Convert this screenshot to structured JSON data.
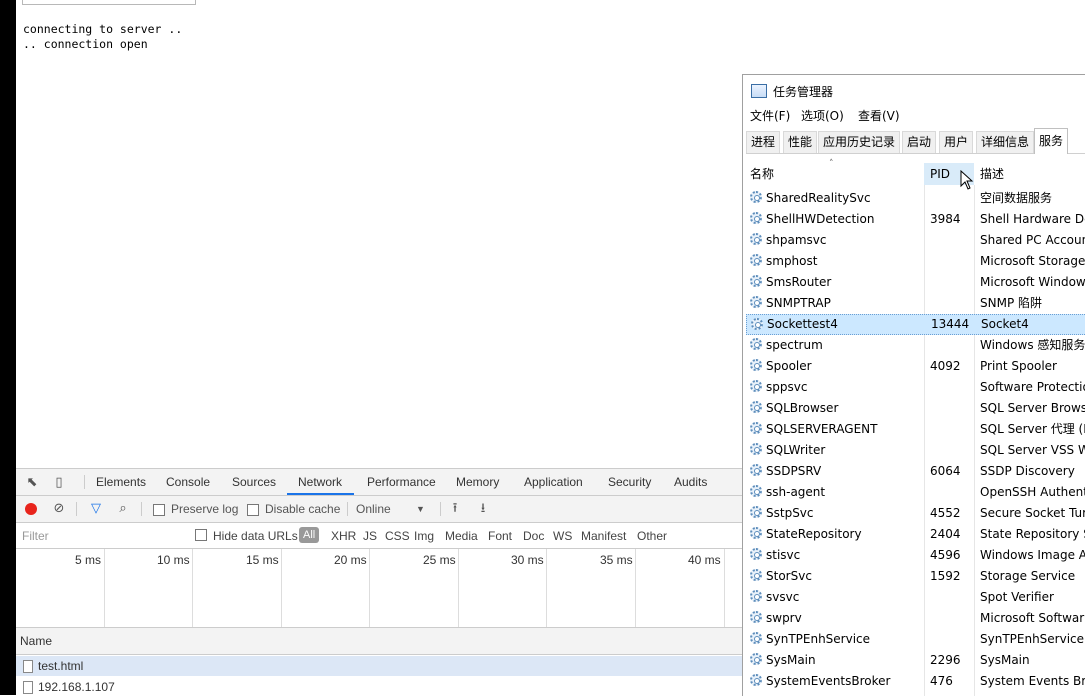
{
  "console": {
    "lines": [
      "connecting to server ..",
      ".. connection open"
    ]
  },
  "devtools": {
    "tabs": [
      "Elements",
      "Console",
      "Sources",
      "Network",
      "Performance",
      "Memory",
      "Application",
      "Security",
      "Audits"
    ],
    "active_tab": "Network",
    "toolbar": {
      "preserve_log": "Preserve log",
      "disable_cache": "Disable cache",
      "throttle": "Online"
    },
    "filter": {
      "placeholder": "Filter",
      "hide_data_urls": "Hide data URLs",
      "types": [
        "All",
        "XHR",
        "JS",
        "CSS",
        "Img",
        "Media",
        "Font",
        "Doc",
        "WS",
        "Manifest",
        "Other"
      ]
    },
    "timeline_ticks": [
      "5 ms",
      "10 ms",
      "15 ms",
      "20 ms",
      "25 ms",
      "30 ms",
      "35 ms",
      "40 ms"
    ],
    "column_name": "Name",
    "requests": [
      "test.html",
      "192.168.1.107"
    ]
  },
  "task_manager": {
    "title": "任务管理器",
    "menu": [
      "文件(F)",
      "选项(O)",
      "查看(V)"
    ],
    "tabs": [
      "进程",
      "性能",
      "应用历史记录",
      "启动",
      "用户",
      "详细信息",
      "服务"
    ],
    "active_tab": "服务",
    "columns": {
      "name": "名称",
      "pid": "PID",
      "desc": "描述"
    },
    "selected_service": "Sockettest4",
    "services": [
      {
        "name": "SharedRealitySvc",
        "pid": "",
        "desc": "空间数据服务"
      },
      {
        "name": "ShellHWDetection",
        "pid": "3984",
        "desc": "Shell Hardware De"
      },
      {
        "name": "shpamsvc",
        "pid": "",
        "desc": "Shared PC Accoun"
      },
      {
        "name": "smphost",
        "pid": "",
        "desc": "Microsoft Storage"
      },
      {
        "name": "SmsRouter",
        "pid": "",
        "desc": "Microsoft Window"
      },
      {
        "name": "SNMPTRAP",
        "pid": "",
        "desc": "SNMP 陷阱"
      },
      {
        "name": "Sockettest4",
        "pid": "13444",
        "desc": "Socket4"
      },
      {
        "name": "spectrum",
        "pid": "",
        "desc": "Windows 感知服务"
      },
      {
        "name": "Spooler",
        "pid": "4092",
        "desc": "Print Spooler"
      },
      {
        "name": "sppsvc",
        "pid": "",
        "desc": "Software Protectio"
      },
      {
        "name": "SQLBrowser",
        "pid": "",
        "desc": "SQL Server Brows"
      },
      {
        "name": "SQLSERVERAGENT",
        "pid": "",
        "desc": "SQL Server 代理 (M"
      },
      {
        "name": "SQLWriter",
        "pid": "",
        "desc": "SQL Server VSS W"
      },
      {
        "name": "SSDPSRV",
        "pid": "6064",
        "desc": "SSDP Discovery"
      },
      {
        "name": "ssh-agent",
        "pid": "",
        "desc": "OpenSSH Authenti"
      },
      {
        "name": "SstpSvc",
        "pid": "4552",
        "desc": "Secure Socket Tur"
      },
      {
        "name": "StateRepository",
        "pid": "2404",
        "desc": "State Repository S"
      },
      {
        "name": "stisvc",
        "pid": "4596",
        "desc": "Windows Image A"
      },
      {
        "name": "StorSvc",
        "pid": "1592",
        "desc": "Storage Service"
      },
      {
        "name": "svsvc",
        "pid": "",
        "desc": "Spot Verifier"
      },
      {
        "name": "swprv",
        "pid": "",
        "desc": "Microsoft Softwar"
      },
      {
        "name": "SynTPEnhService",
        "pid": "",
        "desc": "SynTPEnhService"
      },
      {
        "name": "SysMain",
        "pid": "2296",
        "desc": "SysMain"
      },
      {
        "name": "SystemEventsBroker",
        "pid": "476",
        "desc": "System Events Br"
      }
    ]
  }
}
